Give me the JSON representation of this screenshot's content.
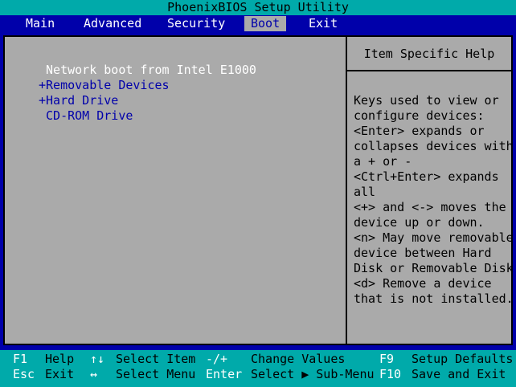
{
  "title": "PhoenixBIOS Setup Utility",
  "menu": {
    "tabs": [
      "Main",
      "Advanced",
      "Security",
      "Boot",
      "Exit"
    ],
    "active": "Boot"
  },
  "boot_items": [
    {
      "label": " Network boot from Intel E1000",
      "selected": true
    },
    {
      "label": "+Removable Devices",
      "selected": false
    },
    {
      "label": "+Hard Drive",
      "selected": false
    },
    {
      "label": " CD-ROM Drive",
      "selected": false
    }
  ],
  "help": {
    "title": "Item Specific Help",
    "lines": [
      "Keys used to view or",
      "configure devices:",
      "<Enter> expands or",
      "collapses devices with",
      "a + or -",
      "<Ctrl+Enter> expands",
      "all",
      "<+> and <-> moves the",
      "device up or down.",
      "<n> May move removable",
      "device between Hard",
      "Disk or Removable Disk",
      "<d> Remove a device",
      "that is not installed."
    ]
  },
  "footer": {
    "row1": [
      {
        "key": "F1",
        "desc": "Help"
      },
      {
        "key": "↑↓",
        "desc": "Select Item"
      },
      {
        "key": "-/+",
        "desc": "Change Values"
      },
      {
        "key": "F9",
        "desc": "Setup Defaults"
      }
    ],
    "row2": [
      {
        "key": "Esc",
        "desc": "Exit"
      },
      {
        "key": "↔",
        "desc": "Select Menu"
      },
      {
        "key": "Enter",
        "desc": "Select ▶ Sub-Menu"
      },
      {
        "key": "F10",
        "desc": "Save and Exit"
      }
    ]
  },
  "colors": {
    "background": "#0000AA",
    "panel": "#AAAAAA",
    "bar": "#00AAAA",
    "highlight_text": "#FFFFFF"
  }
}
